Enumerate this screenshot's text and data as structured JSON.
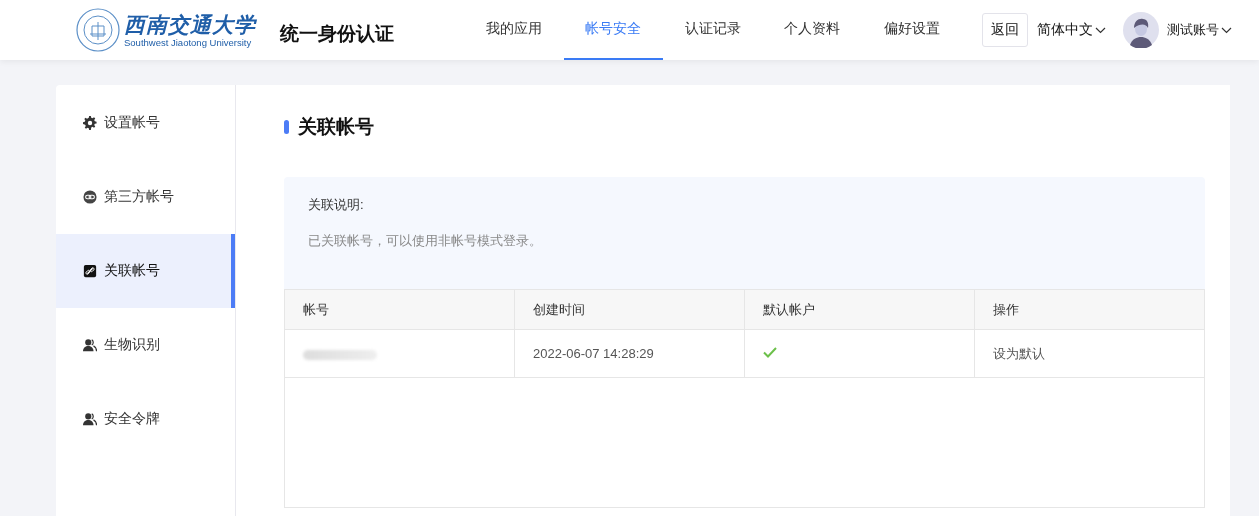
{
  "header": {
    "logo_name": "西南交通大学",
    "logo_subtitle": "Southwest Jiaotong University",
    "title": "统一身份认证",
    "nav": [
      {
        "label": "我的应用",
        "selected": false
      },
      {
        "label": "帐号安全",
        "selected": true
      },
      {
        "label": "认证记录",
        "selected": false
      },
      {
        "label": "个人资料",
        "selected": false
      },
      {
        "label": "偏好设置",
        "selected": false
      }
    ],
    "back_button": "返回",
    "language": "简体中文",
    "user_name": "测试账号"
  },
  "sidebar": {
    "items": [
      {
        "label": "设置帐号",
        "kind": "gear",
        "selected": false
      },
      {
        "label": "第三方帐号",
        "kind": "chain",
        "selected": false
      },
      {
        "label": "关联帐号",
        "kind": "linked",
        "selected": true
      },
      {
        "label": "生物识别",
        "kind": "people",
        "selected": false
      },
      {
        "label": "安全令牌",
        "kind": "people",
        "selected": false
      }
    ]
  },
  "section": {
    "title": "关联帐号",
    "notice": {
      "title": "关联说明:",
      "text": "已关联帐号，可以使用非帐号模式登录。"
    },
    "table": {
      "columns": [
        "帐号",
        "创建时间",
        "默认帐户",
        "操作"
      ],
      "rows": [
        {
          "account_redacted": true,
          "created": "2022-06-07 14:28:29",
          "is_default": true,
          "action": "设为默认"
        }
      ]
    }
  }
}
